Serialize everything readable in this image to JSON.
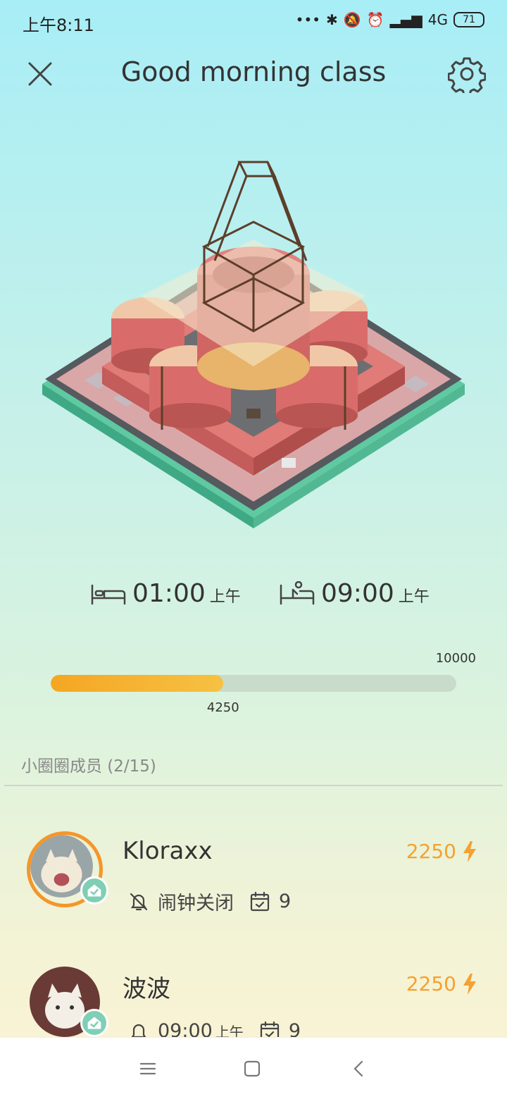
{
  "status": {
    "time": "上午8:11",
    "network": "4G",
    "battery": "71"
  },
  "header": {
    "title": "Good morning class"
  },
  "schedule": {
    "sleep_time": "01:00",
    "sleep_period": "上午",
    "wake_time": "09:00",
    "wake_period": "上午"
  },
  "progress": {
    "current": "4250",
    "max": "10000",
    "fraction": 0.425
  },
  "members": {
    "heading": "小圈圈成员 (2/15)",
    "list": [
      {
        "name": "Kloraxx",
        "energy": "2250",
        "alarm": "闹钟关闭",
        "alarm_period": "",
        "checkins": "9"
      },
      {
        "name": "波波",
        "energy": "2250",
        "alarm": "09:00",
        "alarm_period": "上午",
        "checkins": "9"
      }
    ]
  },
  "colors": {
    "accent": "#f5a623",
    "badge": "#7fcfb4",
    "track": "#c9dccb"
  },
  "icons": {
    "close": "close-icon",
    "settings": "gear-icon",
    "bed": "bed-icon",
    "wake": "wake-up-icon",
    "energy": "lightning-icon",
    "alarm_off": "bell-off-icon",
    "alarm": "bell-icon",
    "calendar": "calendar-check-icon",
    "home": "home-check-icon"
  }
}
